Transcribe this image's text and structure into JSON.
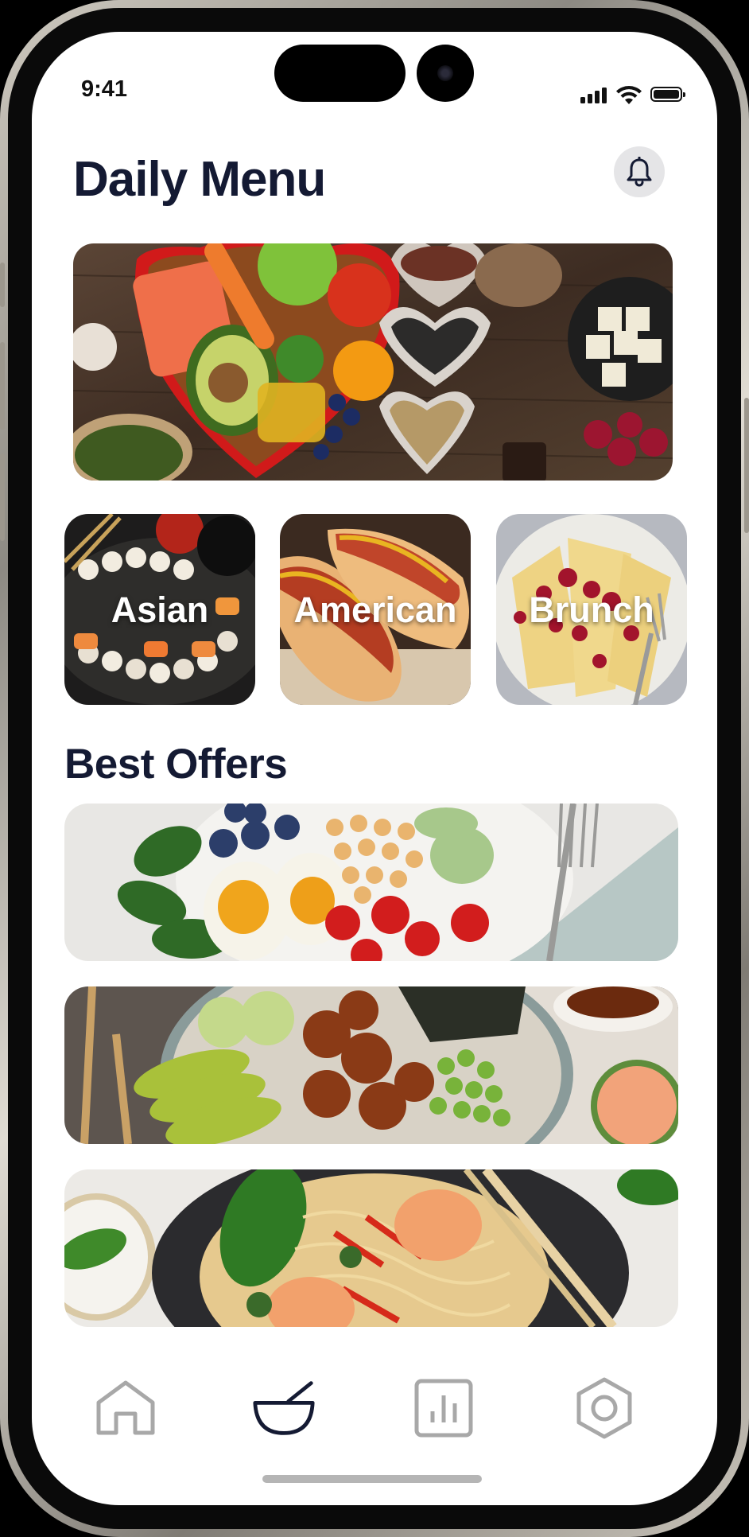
{
  "status_bar": {
    "time": "9:41"
  },
  "header": {
    "title": "Daily Menu"
  },
  "categories": [
    {
      "label": "Asian"
    },
    {
      "label": "American"
    },
    {
      "label": "Brunch"
    }
  ],
  "best_offers": {
    "title": "Best Offers"
  },
  "nav": {
    "items": [
      "home-icon",
      "bowl-icon",
      "chart-icon",
      "settings-icon"
    ],
    "active": "bowl-icon"
  },
  "colors": {
    "title": "#141a33",
    "nav_active": "#141a33",
    "nav_inactive": "#a8a8a8"
  }
}
